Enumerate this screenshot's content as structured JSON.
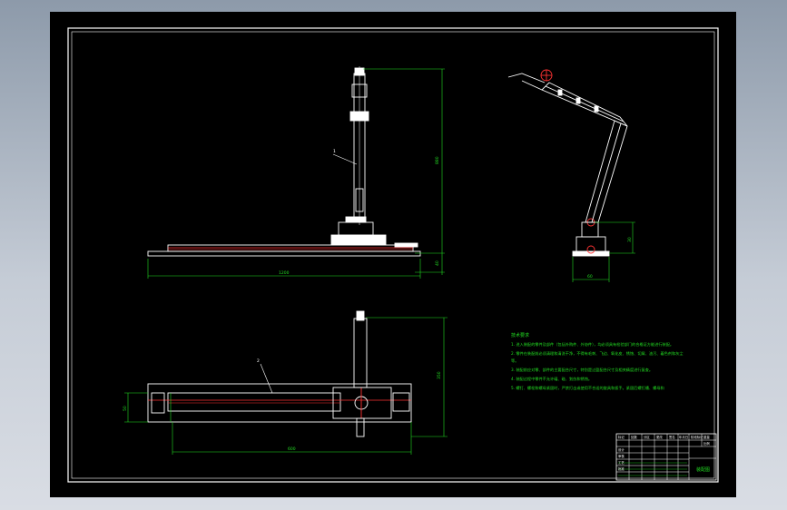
{
  "notes": {
    "title": "技术要求",
    "lines": [
      "1. 进入装配的零件及部件（包括外购件、外协件），均必须具有检验部门的合格证方能进行装配。",
      "2. 零件在装配前必须清理和清洗干净，不得有毛刺、飞边、氧化皮、锈蚀、切屑、油污、着色剂和灰尘",
      "等。",
      "3. 装配前应对零、部件的主要配合尺寸，特别是过盈配合尺寸及相关精度进行复查。",
      "4. 装配过程中零件不允许磕、碰、划伤和锈蚀。",
      "5. 螺钉、螺栓和螺母紧固时，严禁打击或使用不合适的旋具和扳手。紧固后螺钉槽、螺母和"
    ]
  },
  "dimensions": {
    "front_height": "880",
    "front_length": "1200",
    "front_base": "40",
    "side_height": "30",
    "side_base": "60",
    "top_height": "350",
    "top_length": "600",
    "top_width": "50"
  },
  "leaders": {
    "front": "1",
    "top": "2"
  },
  "title_block": {
    "drawing_title": "装配图",
    "cells": [
      "标记",
      "处数",
      "分区",
      "更改",
      "签名",
      "年月日",
      "设计",
      "审核",
      "工艺",
      "批准",
      "阶段标记",
      "重量",
      "比例"
    ]
  },
  "colors": {
    "background": "#000000",
    "lines": "#ffffff",
    "dimensions": "#22dd22",
    "center_lines": "#ff2222"
  }
}
